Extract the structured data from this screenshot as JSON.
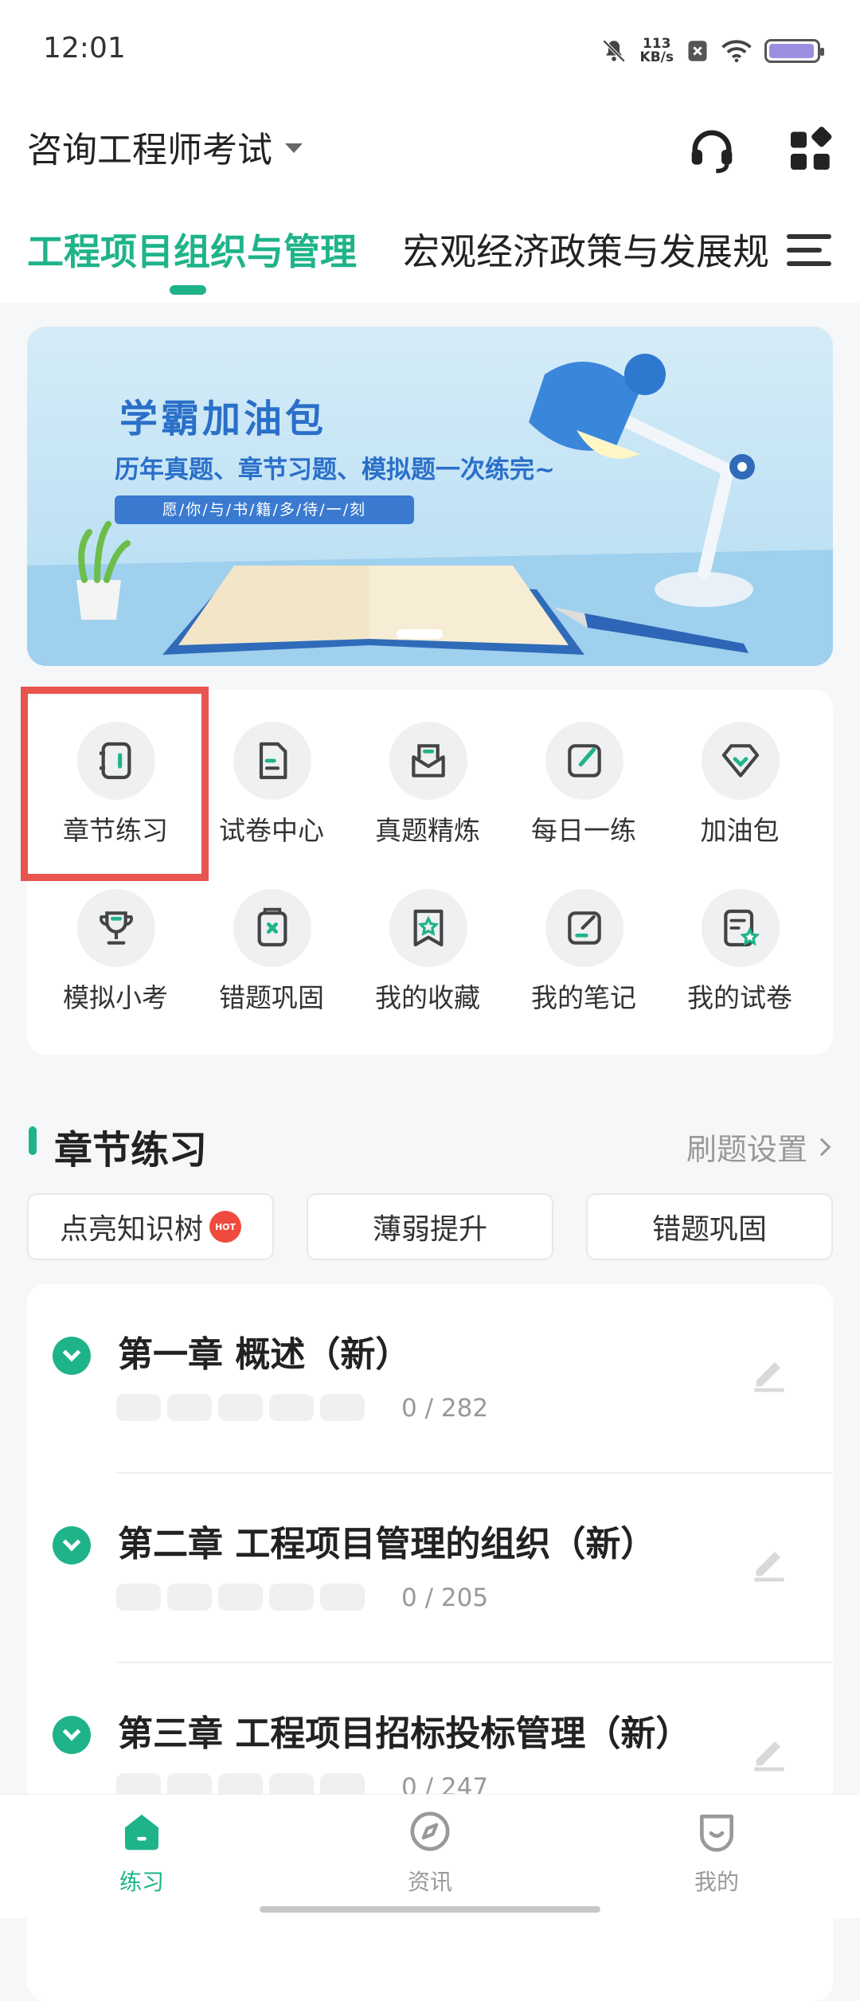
{
  "status_bar": {
    "time": "12:01",
    "net_speed_value": "113",
    "net_speed_unit": "KB/s"
  },
  "header": {
    "exam_title": "咨询工程师考试",
    "icons": [
      "headset-icon",
      "apps-grid-icon"
    ]
  },
  "tabs": [
    {
      "label": "工程项目组织与管理",
      "active": true
    },
    {
      "label": "宏观经济政策与发展规",
      "active": false
    }
  ],
  "banner": {
    "title": "学霸加油包",
    "subtitle": "历年真题、章节习题、模拟题一次练完~",
    "pill": "愿/你/与/书/籍/多/待/一/刻"
  },
  "grid": [
    {
      "label": "章节练习",
      "icon": "chapter-book-icon"
    },
    {
      "label": "试卷中心",
      "icon": "paper-icon"
    },
    {
      "label": "真题精炼",
      "icon": "envelope-icon"
    },
    {
      "label": "每日一练",
      "icon": "daily-edit-icon"
    },
    {
      "label": "加油包",
      "icon": "gem-icon"
    },
    {
      "label": "模拟小考",
      "icon": "trophy-icon"
    },
    {
      "label": "错题巩固",
      "icon": "wrong-question-icon"
    },
    {
      "label": "我的收藏",
      "icon": "star-bookmark-icon"
    },
    {
      "label": "我的笔记",
      "icon": "note-edit-icon"
    },
    {
      "label": "我的试卷",
      "icon": "my-paper-icon"
    }
  ],
  "section": {
    "title": "章节练习",
    "settings_link": "刷题设置"
  },
  "chips": [
    {
      "label": "点亮知识树",
      "badge": "HOT"
    },
    {
      "label": "薄弱提升"
    },
    {
      "label": "错题巩固"
    }
  ],
  "chapters": [
    {
      "title": "第一章 概述（新）",
      "count": "0 / 282"
    },
    {
      "title": "第二章 工程项目管理的组织（新）",
      "count": "0 / 205"
    },
    {
      "title": "第三章 工程项目招标投标管理（新）",
      "count": "0 / 247"
    }
  ],
  "bottom_nav": [
    {
      "label": "练习",
      "icon": "home-icon",
      "active": true
    },
    {
      "label": "资讯",
      "icon": "compass-icon",
      "active": false
    },
    {
      "label": "我的",
      "icon": "smile-icon",
      "active": false
    }
  ],
  "colors": {
    "accent": "#1fb38a",
    "highlight_box": "#e8544e",
    "banner_text": "#2a6fc9"
  }
}
